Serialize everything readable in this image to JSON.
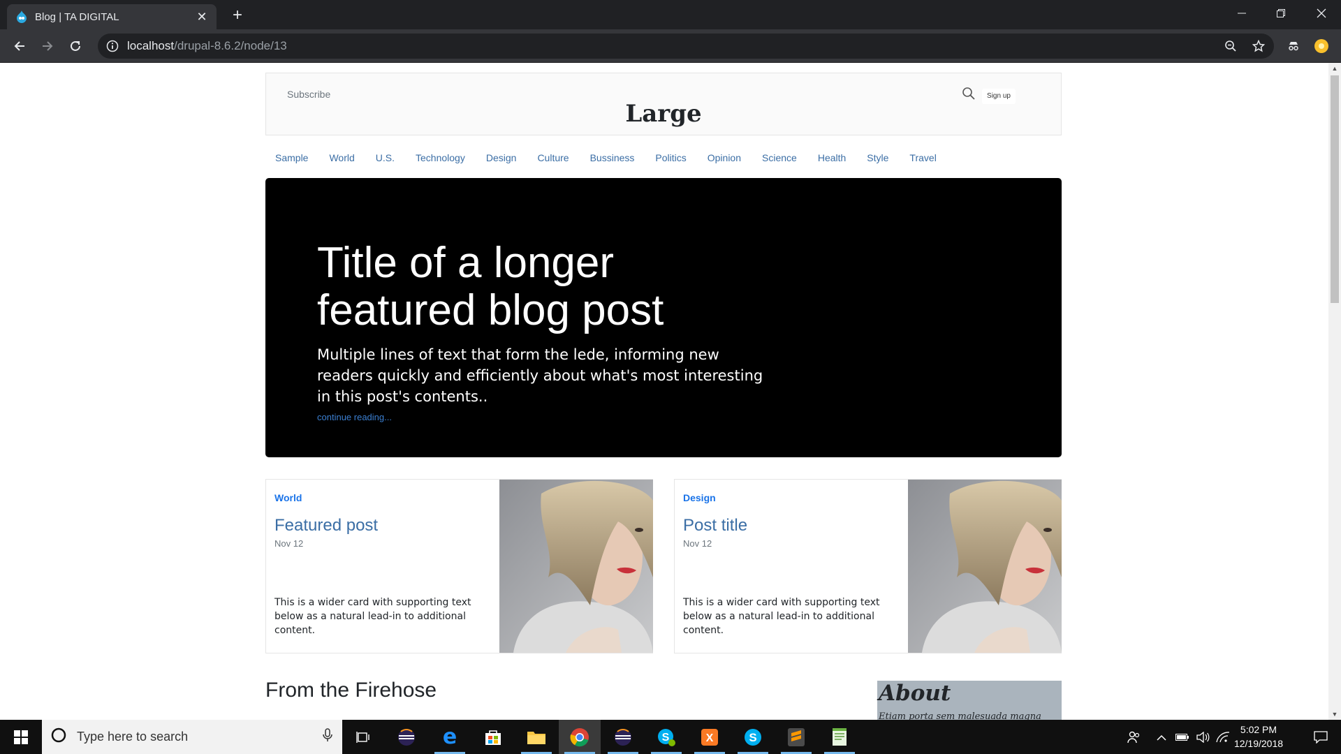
{
  "browser": {
    "tab_title": "Blog | TA DIGITAL",
    "close_glyph": "✕",
    "newtab_glyph": "+",
    "url_host": "localhost",
    "url_path": "/drupal-8.6.2/node/13"
  },
  "site": {
    "subscribe": "Subscribe",
    "logo": "Large",
    "signup": "Sign up",
    "nav": [
      "Sample",
      "World",
      "U.S.",
      "Technology",
      "Design",
      "Culture",
      "Bussiness",
      "Politics",
      "Opinion",
      "Science",
      "Health",
      "Style",
      "Travel"
    ]
  },
  "jumbotron": {
    "title": "Title of a longer featured blog post",
    "lede": "Multiple lines of text that form the lede, informing new readers quickly and efficiently about what's most interesting in this post's contents..",
    "link": "continue reading..."
  },
  "cards": [
    {
      "category": "World",
      "title": "Featured post",
      "date": "Nov 12",
      "text": "This is a wider card with supporting text below as a natural lead-in to additional content."
    },
    {
      "category": "Design",
      "title": "Post title",
      "date": "Nov 12",
      "text": "This is a wider card with supporting text below as a natural lead-in to additional content."
    }
  ],
  "section_heading": "From the Firehose",
  "about": {
    "title": "About",
    "text": "Etiam porta sem malesuada magna"
  },
  "taskbar": {
    "search_placeholder": "Type here to search",
    "time": "5:02 PM",
    "date": "12/19/2018",
    "apps": [
      "eclipse-icon",
      "edge-icon",
      "store-icon",
      "file-explorer-icon",
      "chrome-icon",
      "eclipse-icon",
      "skype-business-icon",
      "xampp-icon",
      "skype-icon",
      "sublime-text-icon",
      "notepad-icon"
    ]
  }
}
